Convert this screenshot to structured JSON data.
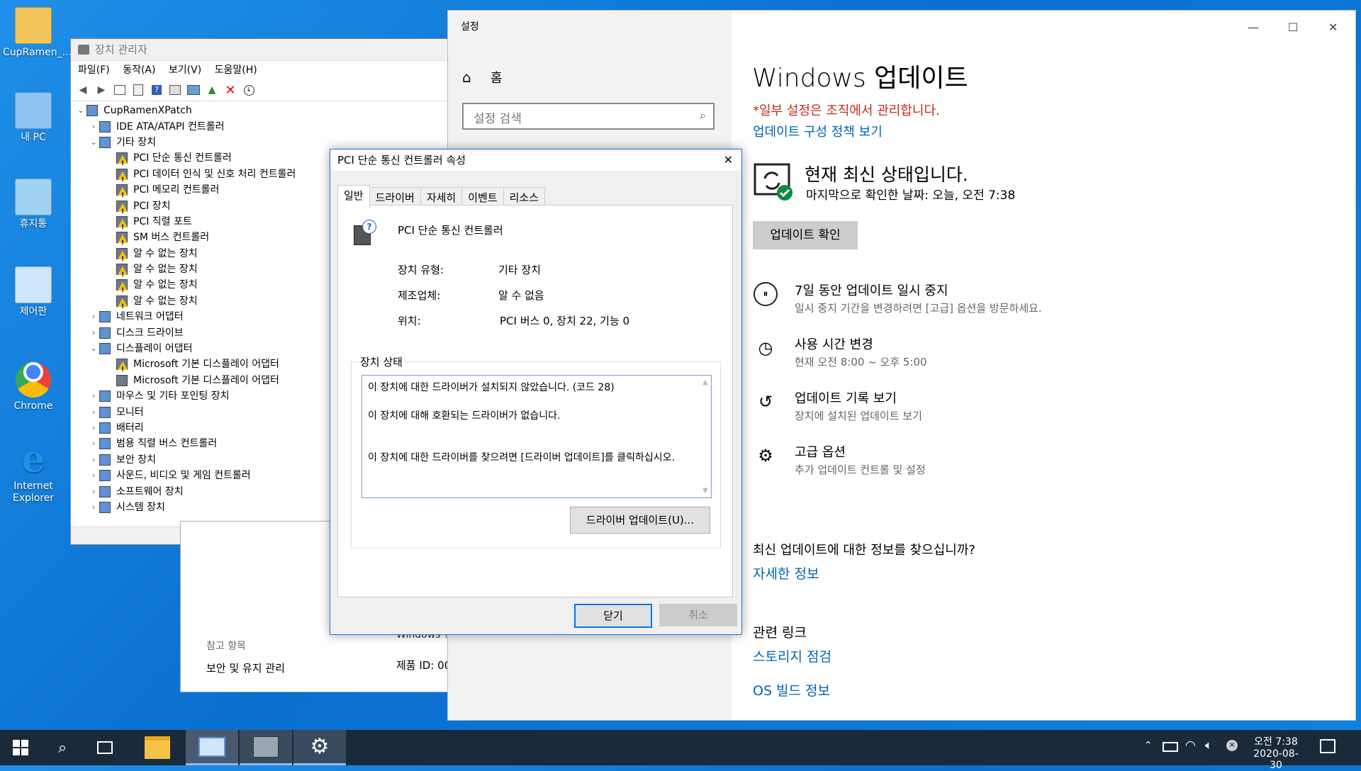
{
  "desktop": {
    "icons": [
      {
        "label": "CupRamen_...",
        "icon": "user-folder-icon"
      },
      {
        "label": "내 PC",
        "icon": "computer-icon"
      },
      {
        "label": "휴지통",
        "icon": "recycle-bin-icon"
      },
      {
        "label": "제어판",
        "icon": "control-panel-icon"
      },
      {
        "label": "Chrome",
        "icon": "chrome-icon"
      },
      {
        "label": "Internet Explorer",
        "icon": "internet-explorer-icon"
      }
    ]
  },
  "device_manager": {
    "title": "장치 관리자",
    "menu": [
      "파일(F)",
      "동작(A)",
      "보기(V)",
      "도움말(H)"
    ],
    "root": "CupRamenXPatch",
    "tree": [
      {
        "label": "IDE ATA/ATAPI 컨트롤러",
        "level": 1,
        "expanded": false,
        "warn": false
      },
      {
        "label": "기타 장치",
        "level": 1,
        "expanded": true,
        "warn": false
      },
      {
        "label": "PCI 단순 통신 컨트롤러",
        "level": 2,
        "warn": true
      },
      {
        "label": "PCI 데이터 인식 및 신호 처리 컨트롤러",
        "level": 2,
        "warn": true
      },
      {
        "label": "PCI 메모리 컨트롤러",
        "level": 2,
        "warn": true
      },
      {
        "label": "PCI 장치",
        "level": 2,
        "warn": true
      },
      {
        "label": "PCI 직렬 포트",
        "level": 2,
        "warn": true
      },
      {
        "label": "SM 버스 컨트롤러",
        "level": 2,
        "warn": true
      },
      {
        "label": "알 수 없는 장치",
        "level": 2,
        "warn": true
      },
      {
        "label": "알 수 없는 장치",
        "level": 2,
        "warn": true
      },
      {
        "label": "알 수 없는 장치",
        "level": 2,
        "warn": true
      },
      {
        "label": "알 수 없는 장치",
        "level": 2,
        "warn": true
      },
      {
        "label": "네트워크 어댑터",
        "level": 1,
        "expanded": false,
        "warn": false
      },
      {
        "label": "디스크 드라이브",
        "level": 1,
        "expanded": false,
        "warn": false
      },
      {
        "label": "디스플레이 어댑터",
        "level": 1,
        "expanded": true,
        "warn": false
      },
      {
        "label": "Microsoft 기본 디스플레이 어댑터",
        "level": 2,
        "warn": true
      },
      {
        "label": "Microsoft 기본 디스플레이 어댑터",
        "level": 2,
        "warn": false
      },
      {
        "label": "마우스 및 기타 포인팅 장치",
        "level": 1,
        "expanded": false,
        "warn": false
      },
      {
        "label": "모니터",
        "level": 1,
        "expanded": false,
        "warn": false
      },
      {
        "label": "배터리",
        "level": 1,
        "expanded": false,
        "warn": false
      },
      {
        "label": "범용 직렬 버스 컨트롤러",
        "level": 1,
        "expanded": false,
        "warn": false
      },
      {
        "label": "보안 장치",
        "level": 1,
        "expanded": false,
        "warn": false
      },
      {
        "label": "사운드, 비디오 및 게임 컨트롤러",
        "level": 1,
        "expanded": false,
        "warn": false
      },
      {
        "label": "소프트웨어 장치",
        "level": 1,
        "expanded": false,
        "warn": false
      },
      {
        "label": "시스템 장치",
        "level": 1,
        "expanded": false,
        "warn": false
      }
    ]
  },
  "system_behind": {
    "see_also": "참고 항목",
    "security_link": "보안 및 유지 관리",
    "windows_text": "Windows ?",
    "product_id": "제품 ID: 00"
  },
  "settings": {
    "title": "설정",
    "home": "홈",
    "search_placeholder": "설정 검색",
    "page_title": "Windows 업데이트",
    "managed_notice": "*일부 설정은 조직에서 관리합니다.",
    "policy_link": "업데이트 구성 정책 보기",
    "status_title": "현재 최신 상태입니다.",
    "status_sub": "마지막으로 확인한 날짜: 오늘, 오전 7:38",
    "check_button": "업데이트 확인",
    "options": [
      {
        "title": "7일 동안 업데이트 일시 중지",
        "desc": "일시 중지 기간을 변경하려면 [고급] 옵션을 방문하세요.",
        "icon": "pause-icon"
      },
      {
        "title": "사용 시간 변경",
        "desc": "현재 오전 8:00 ~ 오후 5:00",
        "icon": "active-hours-icon"
      },
      {
        "title": "업데이트 기록 보기",
        "desc": "장치에 설치된 업데이트 보기",
        "icon": "history-icon"
      },
      {
        "title": "고급 옵션",
        "desc": "추가 업데이트 컨트롤 및 설정",
        "icon": "advanced-options-icon"
      }
    ],
    "info_question": "최신 업데이트에 대한 정보를 찾으십니까?",
    "more_info": "자세한 정보",
    "related_links": "관련 링크",
    "storage_check": "스토리지 점검",
    "os_build": "OS 빌드 정보"
  },
  "dialog": {
    "title": "PCI 단순 통신 컨트롤러 속성",
    "tabs": [
      "일반",
      "드라이버",
      "자세히",
      "이벤트",
      "리소스"
    ],
    "device_name": "PCI 단순 통신 컨트롤러",
    "type_label": "장치 유형:",
    "type_value": "기타 장치",
    "maker_label": "제조업체:",
    "maker_value": "알 수 없음",
    "location_label": "위치:",
    "location_value": "PCI 버스 0, 장치 22, 기능 0",
    "status_group": "장치 상태",
    "status_line1": "이 장치에 대한 드라이버가 설치되지 않았습니다. (코드 28)",
    "status_line2": "이 장치에 대해 호환되는 드라이버가 없습니다.",
    "status_line3": "이 장치에 대한 드라이버를 찾으려면 [드라이버 업데이트]를 클릭하십시오.",
    "update_button": "드라이버 업데이트(U)...",
    "close_button": "닫기",
    "cancel_button": "취소"
  },
  "taskbar": {
    "time": "오전 7:38",
    "date": "2020-08-30"
  }
}
